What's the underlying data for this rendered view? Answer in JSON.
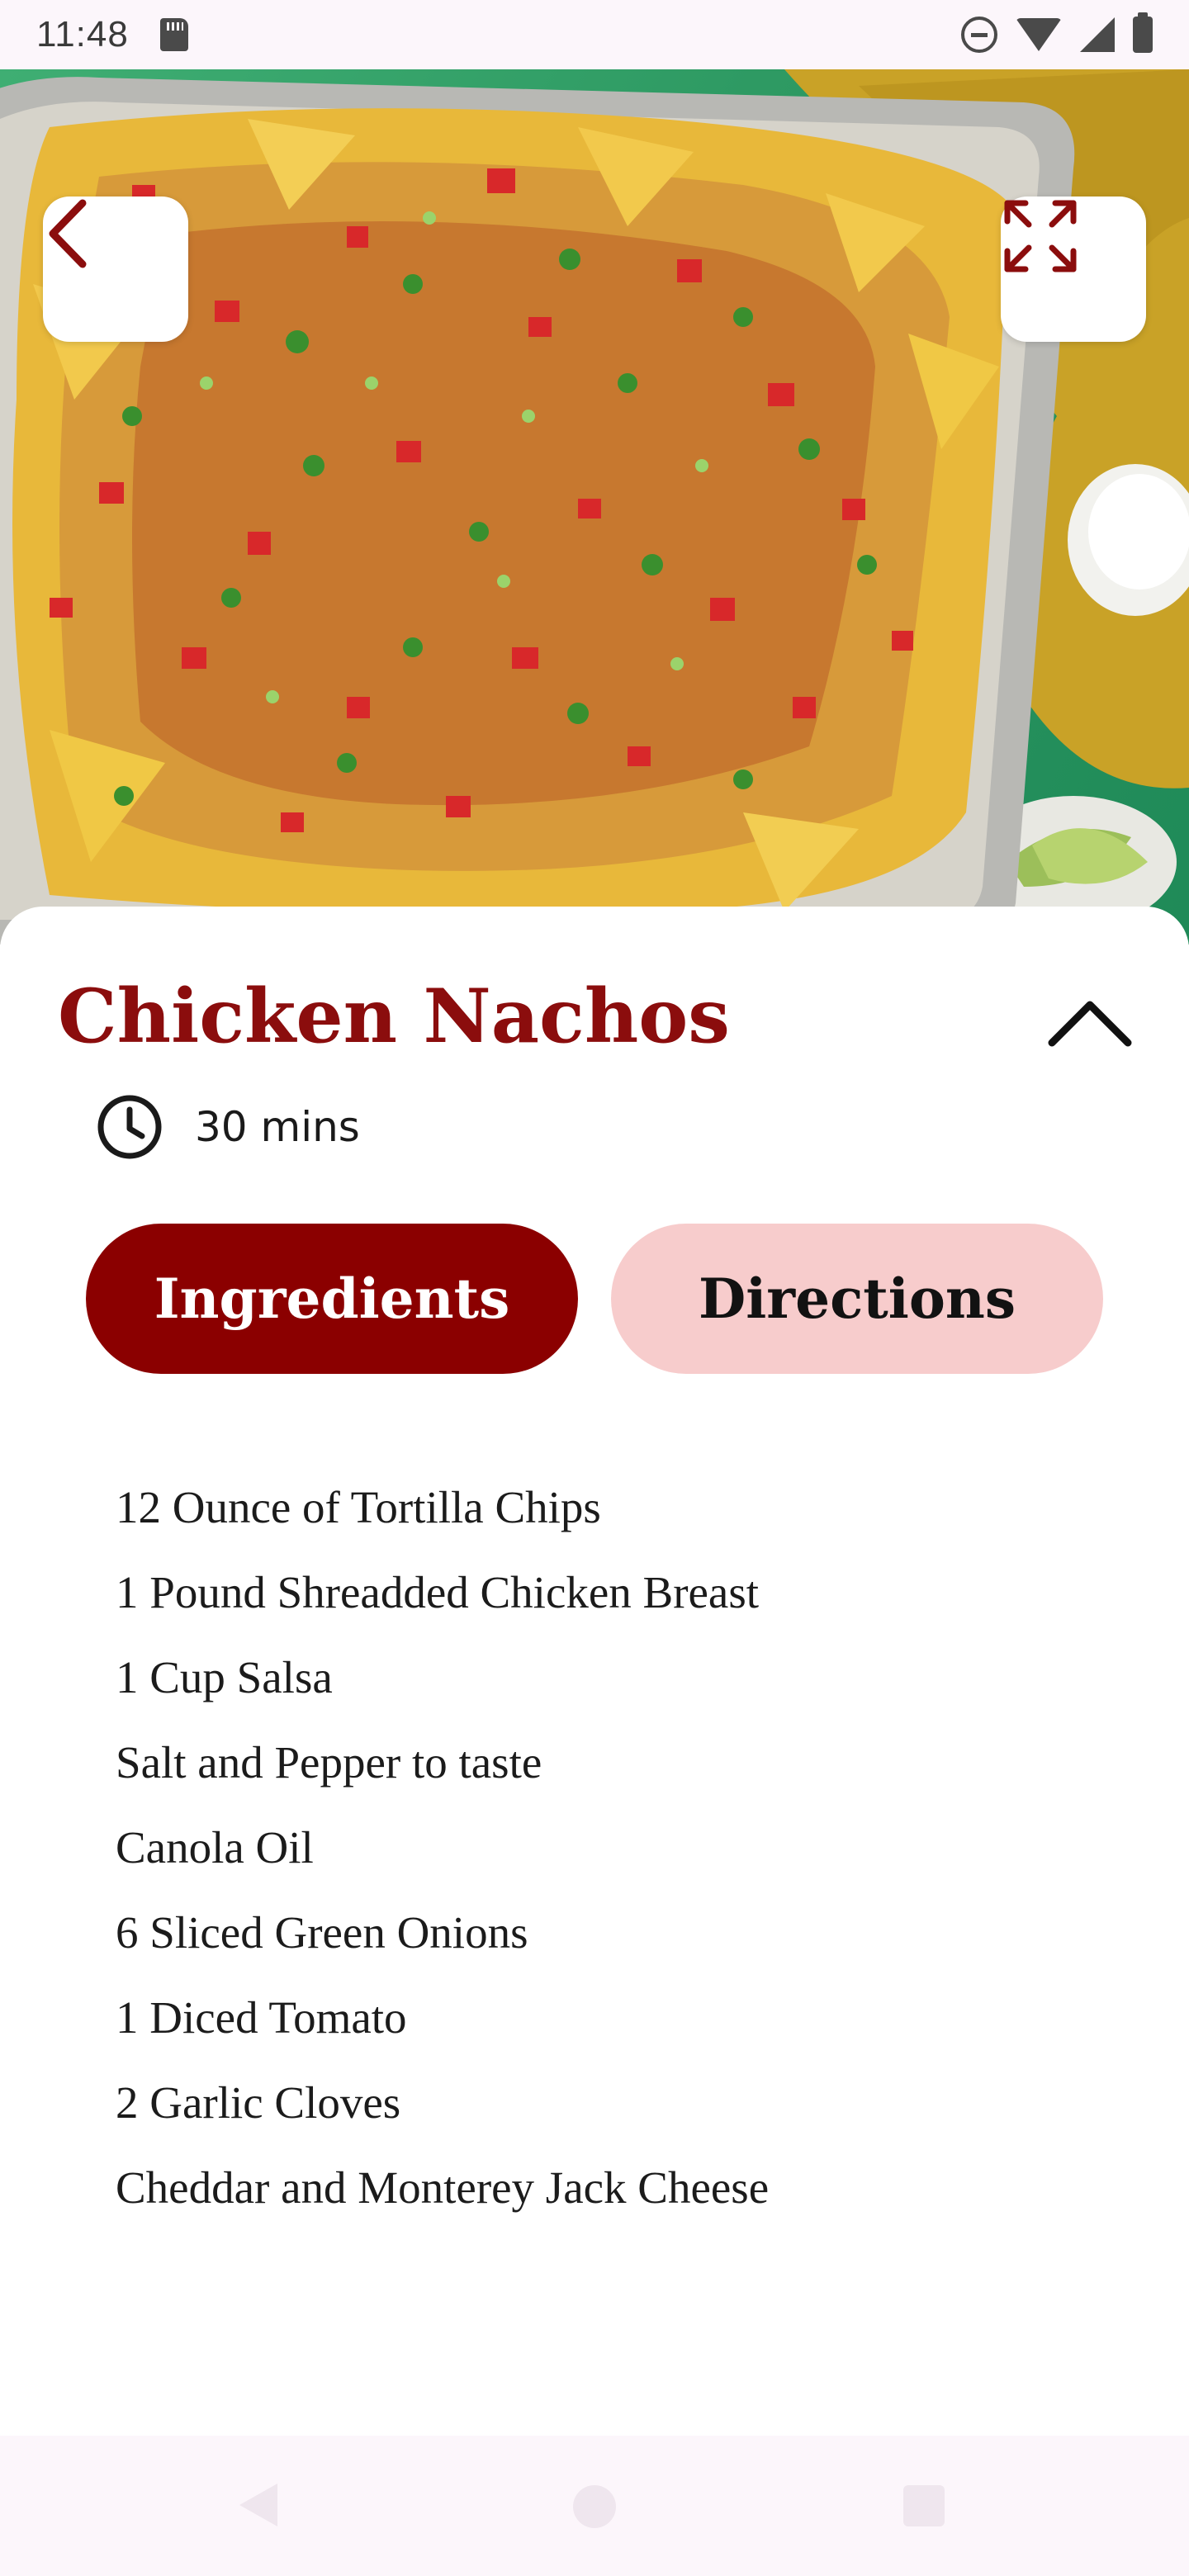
{
  "status_bar": {
    "time": "11:48",
    "icons": [
      "sd-card-icon",
      "do-not-disturb-icon",
      "wifi-icon",
      "signal-icon",
      "battery-icon"
    ]
  },
  "hero": {
    "image": "chicken-nachos-photo",
    "back_icon": "chevron-left-icon",
    "expand_icon": "expand-icon"
  },
  "recipe": {
    "title": "Chicken Nachos",
    "time": "30 mins",
    "collapse_icon": "chevron-up-icon",
    "clock_icon": "clock-icon"
  },
  "tabs": [
    {
      "label": "Ingredients",
      "active": true
    },
    {
      "label": "Directions",
      "active": false
    }
  ],
  "ingredients": [
    "12 Ounce of Tortilla Chips",
    "1 Pound Shreadded Chicken Breast",
    "1 Cup Salsa",
    "Salt and Pepper to taste",
    "Canola Oil",
    "6 Sliced Green Onions",
    "1 Diced Tomato",
    "2 Garlic Cloves",
    "Cheddar and Monterey Jack Cheese"
  ],
  "colors": {
    "accent": "#8b0000",
    "accent_light": "#f7cccc",
    "title": "#8b0d0d"
  },
  "nav_bar": {
    "icons": [
      "nav-back-icon",
      "nav-home-icon",
      "nav-recents-icon"
    ]
  }
}
